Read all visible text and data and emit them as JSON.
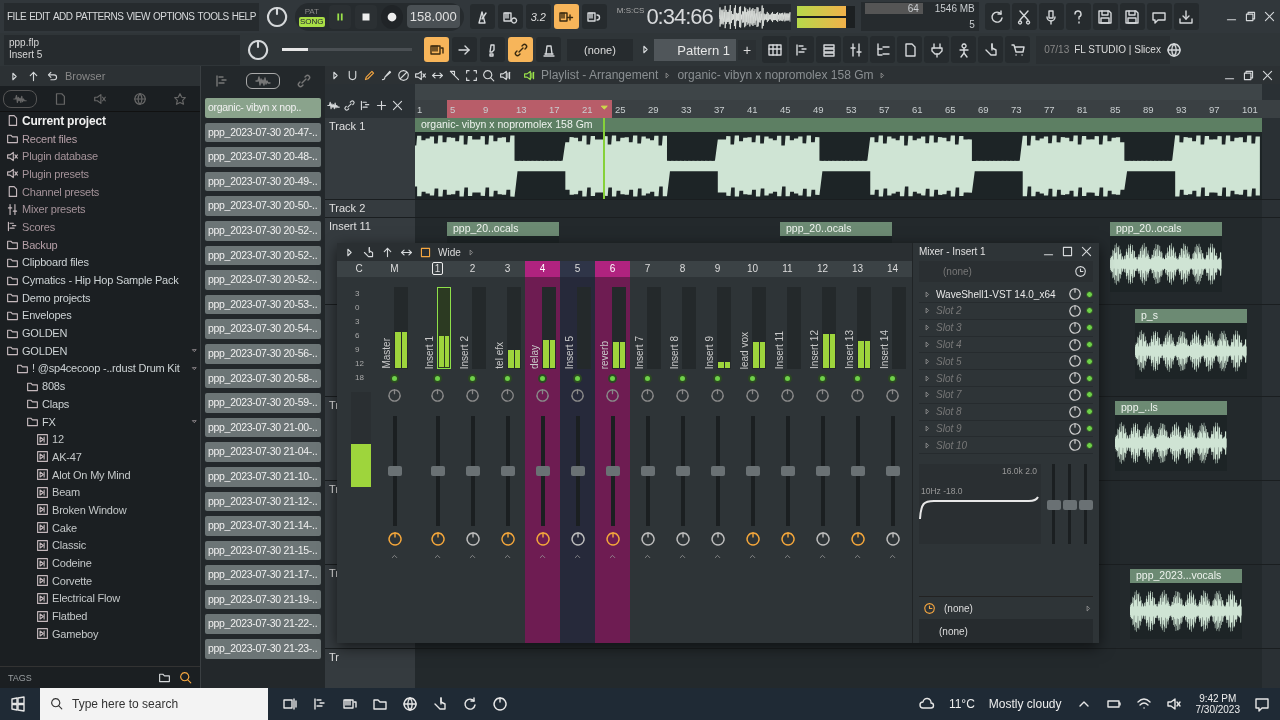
{
  "menu": [
    "FILE",
    "EDIT",
    "ADD",
    "PATTERNS",
    "VIEW",
    "OPTIONS",
    "TOOLS",
    "HELP"
  ],
  "transport": {
    "pat_label": "PAT",
    "song_label": "SONG",
    "song_mode": true,
    "playing": true,
    "tempo": "158.000",
    "time": "0:34:66",
    "time_unit": "M:S:CS"
  },
  "monitor": {
    "level": 0.85,
    "cpu": "64",
    "memory": "1546 MB",
    "polyphony": "5"
  },
  "toggles_top": [
    {
      "on": false
    },
    {
      "on": false
    },
    {
      "label": "3.2",
      "on": false
    },
    {
      "on": true
    },
    {
      "on": false
    }
  ],
  "toggles_bottom": [
    {
      "on": true
    },
    {
      "on": false
    },
    {
      "on": false
    },
    {
      "on": true
    },
    {
      "on": false
    }
  ],
  "hint": {
    "file": "ppp.flp",
    "target": "Insert 5"
  },
  "master_pitch": {
    "level": 0.2
  },
  "snap": "(none)",
  "pattern": {
    "name": "Pattern 1",
    "add": "+"
  },
  "news": {
    "index": "07/13",
    "text": "FL STUDIO | Slicex"
  },
  "browser": {
    "title": "Browser",
    "tags": "TAGS",
    "tabs": [
      {
        "selected": true
      },
      {
        "selected": false
      },
      {
        "selected": false
      },
      {
        "selected": false
      },
      {
        "selected": false
      }
    ],
    "items": [
      {
        "label": "Current project",
        "kind": "project"
      },
      {
        "label": "Recent files",
        "kind": "recent"
      },
      {
        "label": "Plugin database",
        "kind": "plugin"
      },
      {
        "label": "Plugin presets",
        "kind": "plugin"
      },
      {
        "label": "Channel presets",
        "kind": "channel"
      },
      {
        "label": "Mixer presets",
        "kind": "mixer"
      },
      {
        "label": "Scores",
        "kind": "score"
      },
      {
        "label": "Backup",
        "kind": "recent"
      },
      {
        "label": "Clipboard files",
        "kind": "folder",
        "expanded": false
      },
      {
        "label": "Cymatics - Hip Hop Sample Pack",
        "kind": "folder",
        "expanded": false
      },
      {
        "label": "Demo projects",
        "kind": "folder",
        "expanded": false
      },
      {
        "label": "Envelopes",
        "kind": "folder",
        "expanded": false
      },
      {
        "label": "GOLDEN",
        "kind": "folder",
        "expanded": false
      },
      {
        "label": "GOLDEN",
        "kind": "folder",
        "expanded": true,
        "children": [
          {
            "label": "! @sp4cecoop -..rdust Drum Kit",
            "kind": "folder",
            "expanded": true,
            "children": [
              {
                "label": "808s",
                "kind": "folder",
                "expanded": false
              },
              {
                "label": "Claps",
                "kind": "folder",
                "expanded": false
              },
              {
                "label": "FX",
                "kind": "folder",
                "expanded": true,
                "children": [
                  {
                    "label": "12",
                    "kind": "sample"
                  },
                  {
                    "label": "AK-47",
                    "kind": "sample"
                  },
                  {
                    "label": "Alot On My Mind",
                    "kind": "sample"
                  },
                  {
                    "label": "Beam",
                    "kind": "sample"
                  },
                  {
                    "label": "Broken Window",
                    "kind": "sample"
                  },
                  {
                    "label": "Cake",
                    "kind": "sample"
                  },
                  {
                    "label": "Classic",
                    "kind": "sample"
                  },
                  {
                    "label": "Codeine",
                    "kind": "sample"
                  },
                  {
                    "label": "Corvette",
                    "kind": "sample"
                  },
                  {
                    "label": "Electrical Flow",
                    "kind": "sample"
                  },
                  {
                    "label": "Flatbed",
                    "kind": "sample"
                  },
                  {
                    "label": "Gameboy",
                    "kind": "sample"
                  }
                ]
              }
            ]
          }
        ]
      }
    ]
  },
  "clip_tabs": [
    {
      "selected": false
    },
    {
      "selected": true
    },
    {
      "selected": false
    }
  ],
  "clips": [
    {
      "label": "organic- vibyn x nop..",
      "selected": true
    },
    {
      "label": "ppp_2023-07-30 20-47-..",
      "selected": false
    },
    {
      "label": "ppp_2023-07-30 20-48-..",
      "selected": false
    },
    {
      "label": "ppp_2023-07-30 20-49-..",
      "selected": false
    },
    {
      "label": "ppp_2023-07-30 20-50-..",
      "selected": false
    },
    {
      "label": "ppp_2023-07-30 20-52-..",
      "selected": false
    },
    {
      "label": "ppp_2023-07-30 20-52-..",
      "selected": false
    },
    {
      "label": "ppp_2023-07-30 20-52-..",
      "selected": false
    },
    {
      "label": "ppp_2023-07-30 20-53-..",
      "selected": false
    },
    {
      "label": "ppp_2023-07-30 20-54-..",
      "selected": false
    },
    {
      "label": "ppp_2023-07-30 20-56-..",
      "selected": false
    },
    {
      "label": "ppp_2023-07-30 20-58-..",
      "selected": false
    },
    {
      "label": "ppp_2023-07-30 20-59-..",
      "selected": false
    },
    {
      "label": "ppp_2023-07-30 21-00-..",
      "selected": false
    },
    {
      "label": "ppp_2023-07-30 21-04-..",
      "selected": false
    },
    {
      "label": "ppp_2023-07-30 21-10-..",
      "selected": false
    },
    {
      "label": "ppp_2023-07-30 21-12-..",
      "selected": false
    },
    {
      "label": "ppp_2023-07-30 21-14-..",
      "selected": false
    },
    {
      "label": "ppp_2023-07-30 21-15-..",
      "selected": false
    },
    {
      "label": "ppp_2023-07-30 21-17-..",
      "selected": false
    },
    {
      "label": "ppp_2023-07-30 21-19-..",
      "selected": false
    },
    {
      "label": "ppp_2023-07-30 21-22-..",
      "selected": false
    },
    {
      "label": "ppp_2023-07-30 21-23-..",
      "selected": false
    }
  ],
  "playlist": {
    "title": "Playlist - Arrangement",
    "song": "organic- vibyn x nopromolex 158 Gm",
    "ruler": [
      "1",
      "5",
      "9",
      "13",
      "17",
      "21",
      "25",
      "29",
      "33",
      "37",
      "41",
      "45",
      "49",
      "53",
      "57",
      "61",
      "65",
      "69",
      "73",
      "77",
      "81",
      "85",
      "89",
      "93",
      "97",
      "101"
    ],
    "tracks": [
      {
        "name": "Track 1",
        "clips": [
          {
            "label": "organic- vibyn x nopromolex 158 Gm"
          }
        ]
      },
      {
        "name": "Track 2"
      },
      {
        "name": "Insert 11",
        "clips": [
          {
            "label": "ppp_20..ocals"
          },
          {
            "label": "ppp_20..ocals"
          },
          {
            "label": "ppp_20..ocals"
          }
        ]
      },
      {
        "clips": [
          {
            "label": "p_s"
          }
        ]
      },
      {
        "name": "Tr",
        "clips": [
          {
            "label": "ppp_..ls"
          }
        ]
      },
      {
        "name": "Tr"
      },
      {
        "name": "Tr",
        "clips": [
          {
            "label": "ppp_2023...vocals"
          }
        ]
      },
      {
        "name": "Tr"
      }
    ]
  },
  "mixer": {
    "preset": "Wide",
    "side_label": "C",
    "scale": [
      "3",
      "0",
      "3",
      "6",
      "9",
      "12",
      "18"
    ],
    "side_meter": {
      "level": 0.45
    },
    "strips": [
      {
        "number": "M",
        "name": "Master",
        "level": 0.45,
        "selected": false,
        "current": false,
        "highlighted": false,
        "routed": true
      },
      {
        "number": "1",
        "name": "Insert 1",
        "level": 0.4,
        "selected": false,
        "current": true,
        "highlighted": false,
        "routed": true
      },
      {
        "number": "2",
        "name": "Insert 2",
        "level": 0,
        "selected": false,
        "current": false,
        "highlighted": false,
        "routed": false
      },
      {
        "number": "3",
        "name": "tel efx",
        "level": 0.22,
        "selected": false,
        "current": false,
        "highlighted": false,
        "routed": true
      },
      {
        "number": "4",
        "name": "delay",
        "level": 0.35,
        "selected": true,
        "current": false,
        "highlighted": false,
        "routed": true
      },
      {
        "number": "5",
        "name": "Insert 5",
        "level": 0,
        "selected": false,
        "current": false,
        "highlighted": true,
        "routed": false
      },
      {
        "number": "6",
        "name": "reverb",
        "level": 0.32,
        "selected": true,
        "current": false,
        "highlighted": false,
        "routed": true
      },
      {
        "number": "7",
        "name": "Insert 7",
        "level": 0,
        "selected": false,
        "current": false,
        "highlighted": false,
        "routed": false
      },
      {
        "number": "8",
        "name": "Insert 8",
        "level": 0,
        "selected": false,
        "current": false,
        "highlighted": false,
        "routed": false
      },
      {
        "number": "9",
        "name": "Insert 9",
        "level": 0.08,
        "selected": false,
        "current": false,
        "highlighted": false,
        "routed": false
      },
      {
        "number": "10",
        "name": "lead vox",
        "level": 0.33,
        "selected": false,
        "current": false,
        "highlighted": false,
        "routed": true
      },
      {
        "number": "11",
        "name": "Insert 11",
        "level": 0,
        "selected": false,
        "current": false,
        "highlighted": false,
        "routed": true
      },
      {
        "number": "12",
        "name": "Insert 12",
        "level": 0.42,
        "selected": false,
        "current": false,
        "highlighted": false,
        "routed": false
      },
      {
        "number": "13",
        "name": "Insert 13",
        "level": 0.34,
        "selected": false,
        "current": false,
        "highlighted": false,
        "routed": true
      },
      {
        "number": "14",
        "name": "Insert 14",
        "level": 0,
        "selected": false,
        "current": false,
        "highlighted": false,
        "routed": false
      }
    ],
    "insert": {
      "title": "Mixer - Insert 1",
      "input": "(none)",
      "slots": [
        {
          "name": "WaveShell1-VST 14.0_x64",
          "kind": "plugin",
          "enabled": true
        },
        {
          "name": "Slot 2",
          "kind": "empty",
          "enabled": true
        },
        {
          "name": "Slot 3",
          "kind": "empty",
          "enabled": true
        },
        {
          "name": "Slot 4",
          "kind": "empty",
          "enabled": true
        },
        {
          "name": "Slot 5",
          "kind": "empty",
          "enabled": true
        },
        {
          "name": "Slot 6",
          "kind": "empty",
          "enabled": true
        },
        {
          "name": "Slot 7",
          "kind": "empty",
          "enabled": true
        },
        {
          "name": "Slot 8",
          "kind": "empty",
          "enabled": true
        },
        {
          "name": "Slot 9",
          "kind": "empty",
          "enabled": true
        },
        {
          "name": "Slot 10",
          "kind": "empty",
          "enabled": true
        }
      ],
      "eq_high": "16.0k 2.0",
      "eq_low": "10Hz -18.0",
      "output": "(none)",
      "output_2": "(none)"
    }
  },
  "taskbar": {
    "search": {
      "placeholder": "Type here to search"
    },
    "temperature": "11°C",
    "weather": "Mostly cloudy",
    "time": "9:42 PM",
    "date": "7/30/2023"
  }
}
